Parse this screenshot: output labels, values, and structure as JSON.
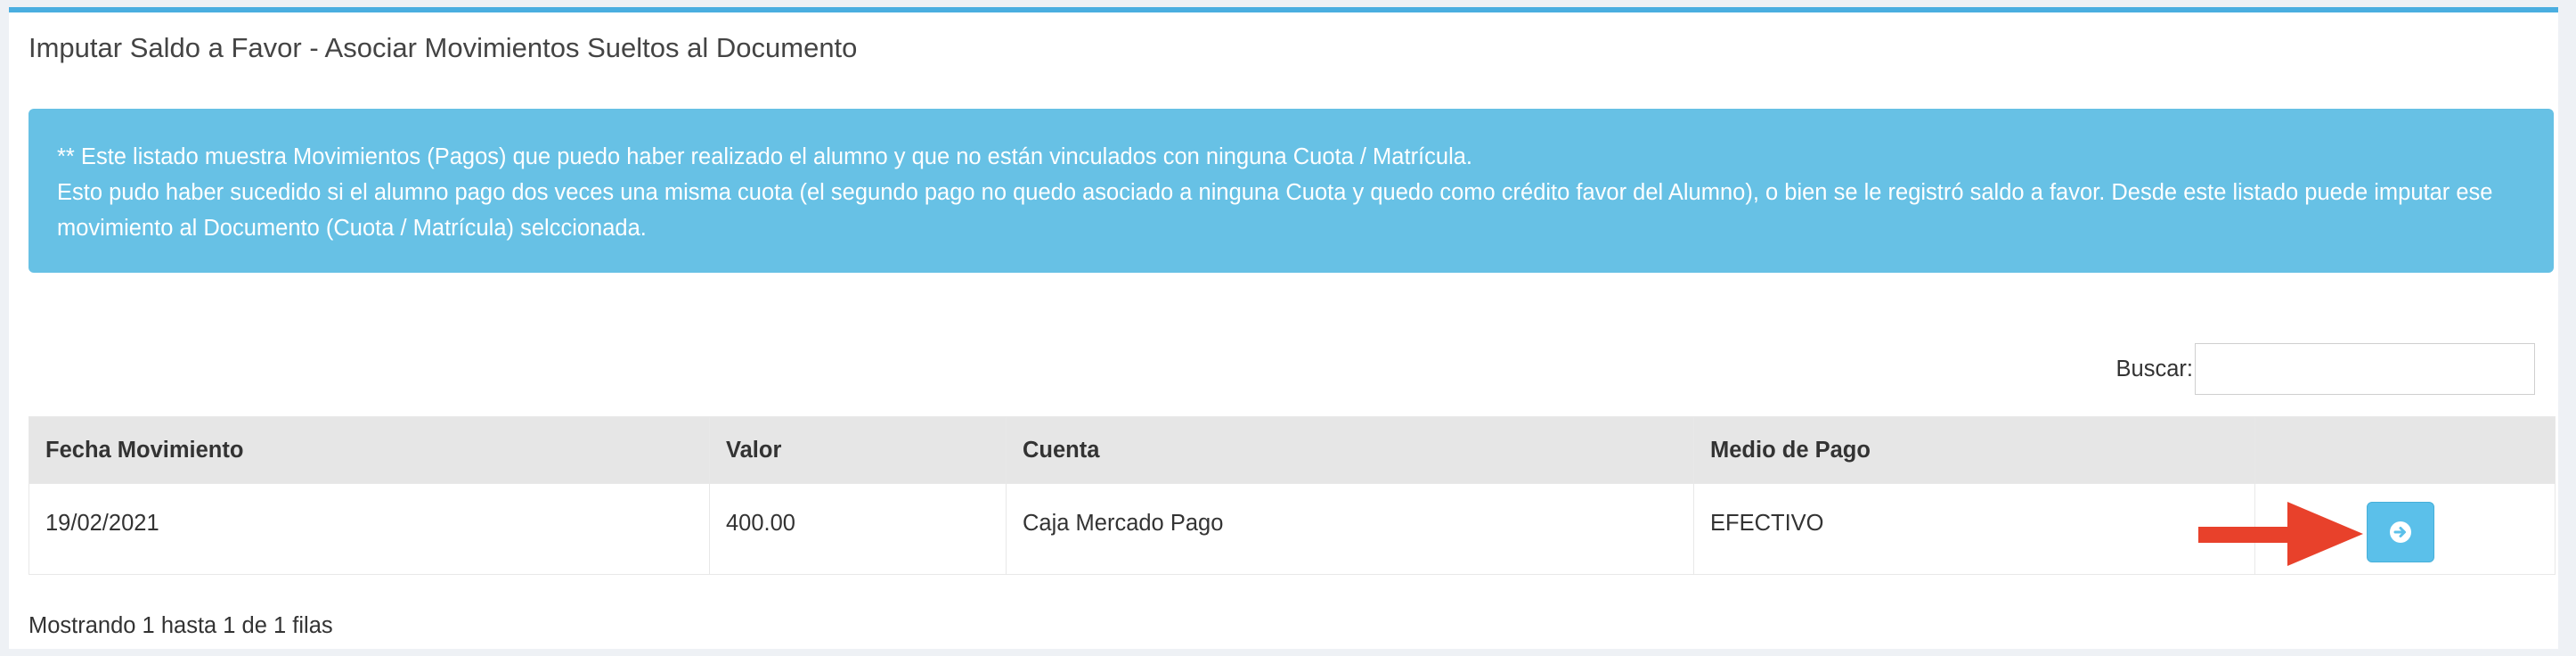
{
  "panel": {
    "title": "Imputar Saldo a Favor - Asociar Movimientos Sueltos al Documento"
  },
  "alert": {
    "line1": "** Este listado muestra Movimientos (Pagos) que puedo haber realizado el alumno y que no están vinculados con ninguna Cuota / Matrícula.",
    "line2": "Esto pudo haber sucedido si el alumno pago dos veces una misma cuota (el segundo pago no quedo asociado a ninguna Cuota y quedo como crédito favor del Alumno), o bien se le registró saldo a favor. Desde este listado puede imputar ese movimiento al Documento (Cuota / Matrícula) selccionada.",
    "color": "#67c1e5"
  },
  "search": {
    "label": "Buscar:",
    "value": ""
  },
  "table": {
    "headers": [
      "Fecha Movimiento",
      "Valor",
      "Cuenta",
      "Medio de Pago",
      ""
    ],
    "rows": [
      {
        "fecha": "19/02/2021",
        "valor": "400.00",
        "cuenta": "Caja Mercado Pago",
        "medio": "EFECTIVO",
        "action_icon": "arrow-circle-right-icon"
      }
    ]
  },
  "footer": {
    "pagination_text": "Mostrando 1 hasta 1 de 1 filas"
  },
  "annotation": {
    "arrow_color": "#e8412b",
    "arrow_icon": "red-arrow-annotation"
  },
  "colors": {
    "header_border": "#4aaee0",
    "button": "#5bc0ea"
  }
}
